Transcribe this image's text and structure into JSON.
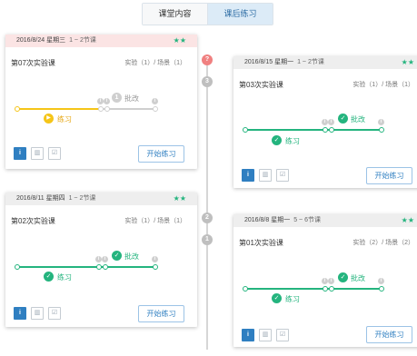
{
  "tabs": [
    "课堂内容",
    "课后练习"
  ],
  "colors": {
    "green": "#24b47e",
    "yellow": "#f5c518",
    "blue": "#2f7fc1",
    "pinkHeader": "#fbe4e4",
    "greyHeader": "#eeeeee"
  },
  "timeline_nodes": [
    "?",
    "3",
    "2",
    "1"
  ],
  "cards": [
    {
      "date": "2016/8/24 星期三",
      "slot": "1 ~ 2节课",
      "stars": "★★",
      "title": "第07次实验课",
      "meta": "实验（1）/ 场景（1）",
      "marks": [
        "i",
        "i",
        "i"
      ],
      "step_num": "1",
      "labels": {
        "practice": "练习",
        "review": "批改"
      },
      "button": "开始练习"
    },
    {
      "date": "2016/8/15 星期一",
      "slot": "1 ~ 2节课",
      "stars": "★★",
      "title": "第03次实验课",
      "meta": "实验（1）/ 场景（1）",
      "marks": [
        "i",
        "i",
        "i"
      ],
      "labels": {
        "practice": "练习",
        "review": "批改"
      },
      "button": "开始练习"
    },
    {
      "date": "2016/8/11 星期四",
      "slot": "1 ~ 2节课",
      "stars": "★★",
      "title": "第02次实验课",
      "meta": "实验（1）/ 场景（1）",
      "marks": [
        "i",
        "i",
        "i"
      ],
      "labels": {
        "practice": "练习",
        "review": "批改"
      },
      "button": "开始练习"
    },
    {
      "date": "2016/8/8 星期一",
      "slot": "5 ~ 6节课",
      "stars": "★★",
      "title": "第01次实验课",
      "meta": "实验（2）/ 场景（2）",
      "marks": [
        "i",
        "i",
        "i"
      ],
      "labels": {
        "practice": "练习",
        "review": "批改"
      },
      "button": "开始练习"
    }
  ],
  "icon_buttons": [
    "info-icon",
    "chart-icon",
    "check-square-icon"
  ]
}
